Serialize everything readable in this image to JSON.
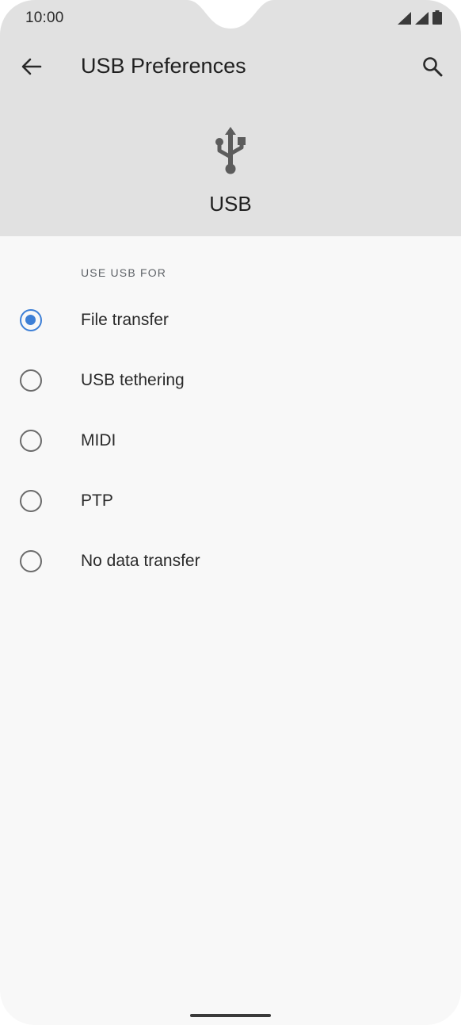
{
  "status_bar": {
    "time": "10:00",
    "icons": [
      "signal-icon",
      "signal-icon",
      "battery-icon"
    ]
  },
  "app_bar": {
    "back_icon": "arrow-left-icon",
    "title": "USB Preferences",
    "search_icon": "search-icon"
  },
  "hero": {
    "icon": "usb-icon",
    "label": "USB"
  },
  "section": {
    "header": "USE USB FOR",
    "options": [
      {
        "label": "File transfer",
        "selected": true
      },
      {
        "label": "USB tethering",
        "selected": false
      },
      {
        "label": "MIDI",
        "selected": false
      },
      {
        "label": "PTP",
        "selected": false
      },
      {
        "label": "No data transfer",
        "selected": false
      }
    ]
  },
  "colors": {
    "header_bg": "#e1e1e1",
    "body_bg": "#f8f8f8",
    "accent": "#3d7fd6"
  }
}
